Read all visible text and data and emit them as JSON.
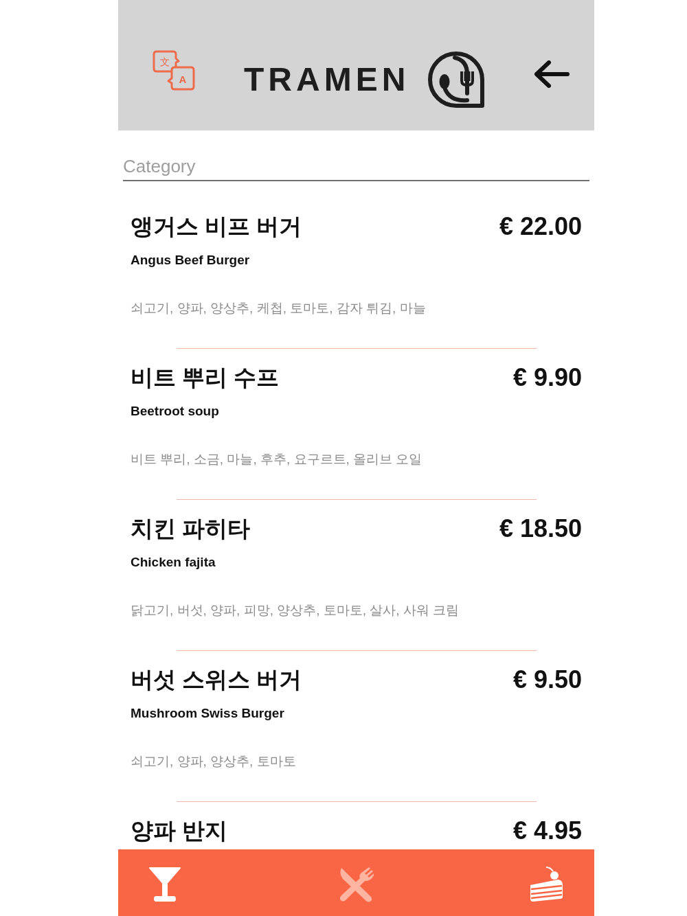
{
  "header": {
    "translate_icon": {
      "glyphs": [
        "文",
        "A"
      ]
    },
    "logo": {
      "text": "TRAMEN"
    }
  },
  "category_field": {
    "placeholder": "Category"
  },
  "menu_items": [
    {
      "name": "앵거스 비프 버거",
      "price": "€ 22.00",
      "english_name": "Angus Beef Burger",
      "ingredients": "쇠고기, 양파, 양상추, 케첩, 토마토, 감자 튀김, 마늘"
    },
    {
      "name": "비트 뿌리 수프",
      "price": "€ 9.90",
      "english_name": "Beetroot soup",
      "ingredients": "비트 뿌리, 소금, 마늘, 후추, 요구르트, 올리브 오일"
    },
    {
      "name": "치킨 파히타",
      "price": "€ 18.50",
      "english_name": "Chicken fajita",
      "ingredients": "닭고기, 버섯, 양파, 피망, 양상추, 토마토, 살사, 사워 크림"
    },
    {
      "name": "버섯 스위스 버거",
      "price": "€ 9.50",
      "english_name": "Mushroom Swiss Burger",
      "ingredients": "쇠고기, 양파, 양상추, 토마토"
    },
    {
      "name": "양파 반지",
      "price": "€ 4.95"
    }
  ],
  "bottom_nav": [
    {
      "kind": "glass",
      "selected": false
    },
    {
      "kind": "utensils",
      "selected": true
    },
    {
      "kind": "cake",
      "selected": false
    }
  ]
}
